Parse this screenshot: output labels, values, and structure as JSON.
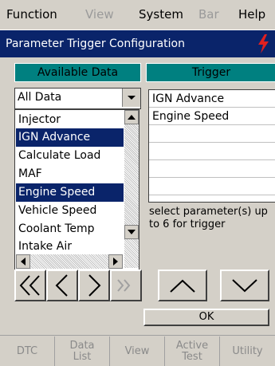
{
  "menu": {
    "items": [
      {
        "label": "Function",
        "disabled": false
      },
      {
        "label": "View",
        "disabled": true
      },
      {
        "label": "System",
        "disabled": false
      },
      {
        "label": "Bar",
        "disabled": true
      },
      {
        "label": "Help",
        "disabled": false
      }
    ]
  },
  "window": {
    "title": "Parameter Trigger Configuration"
  },
  "panel": {
    "available_header": "Available Data",
    "trigger_header": "Trigger",
    "filter_value": "All Data",
    "available_items": [
      {
        "label": "Injector",
        "selected": false
      },
      {
        "label": "IGN Advance",
        "selected": true
      },
      {
        "label": "Calculate Load",
        "selected": false
      },
      {
        "label": "MAF",
        "selected": false
      },
      {
        "label": "Engine Speed",
        "selected": true
      },
      {
        "label": "Vehicle Speed",
        "selected": false
      },
      {
        "label": "Coolant Temp",
        "selected": false
      },
      {
        "label": "Intake Air",
        "selected": false
      }
    ],
    "trigger_items": [
      "IGN Advance",
      "Engine Speed",
      "",
      "",
      "",
      ""
    ],
    "hint": "select parameter(s) up\nto 6 for trigger",
    "ok_label": "OK"
  },
  "tabs": [
    {
      "label": "DTC"
    },
    {
      "label": "Data\nList"
    },
    {
      "label": "View"
    },
    {
      "label": "Active\nTest"
    },
    {
      "label": "Utility"
    }
  ],
  "colors": {
    "title_bg": "#0a246a",
    "header_teal": "#008080",
    "selection": "#0a246a",
    "face": "#d4d0c8"
  }
}
